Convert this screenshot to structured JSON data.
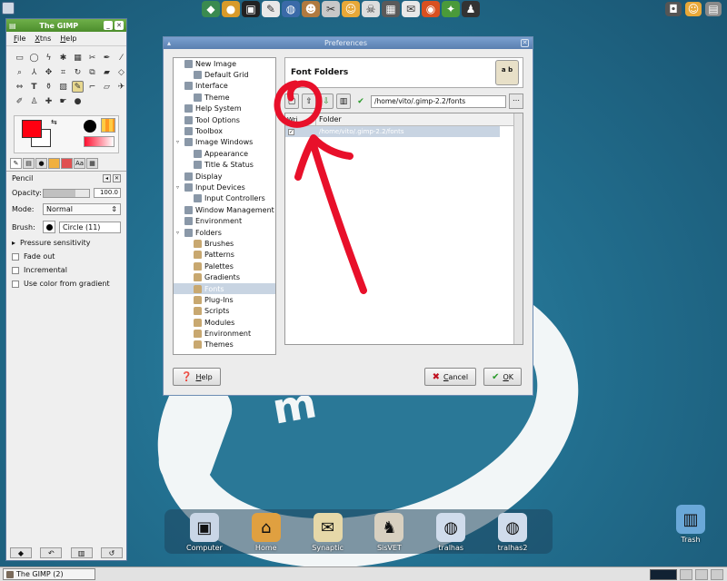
{
  "top_launchers": [
    "file-manager-icon",
    "gimp-icon",
    "terminal-icon",
    "text-editor-icon",
    "web-icon",
    "gimp-wilber-icon",
    "tools-icon",
    "cat-icon",
    "media-icon",
    "cpu-icon",
    "email-icon",
    "firefox-icon",
    "puzzle-icon",
    "penguin-icon"
  ],
  "toolbox": {
    "title": "The GIMP",
    "menu": [
      "File",
      "Xtns",
      "Help"
    ],
    "tool_options_title": "Pencil",
    "opacity_label": "Opacity:",
    "opacity_value": "100.0",
    "mode_label": "Mode:",
    "mode_value": "Normal",
    "brush_label": "Brush:",
    "brush_value": "Circle (11)",
    "pressure_label": "Pressure sensitivity",
    "options": [
      "Fade out",
      "Incremental",
      "Use color from gradient"
    ]
  },
  "prefs": {
    "title": "Preferences",
    "tree": [
      {
        "label": "New Image",
        "level": 0
      },
      {
        "label": "Default Grid",
        "level": 1
      },
      {
        "label": "Interface",
        "level": 0
      },
      {
        "label": "Theme",
        "level": 1
      },
      {
        "label": "Help System",
        "level": 0
      },
      {
        "label": "Tool Options",
        "level": 0
      },
      {
        "label": "Toolbox",
        "level": 0
      },
      {
        "label": "Image Windows",
        "level": 0,
        "expander": "▿"
      },
      {
        "label": "Appearance",
        "level": 1
      },
      {
        "label": "Title & Status",
        "level": 1
      },
      {
        "label": "Display",
        "level": 0
      },
      {
        "label": "Input Devices",
        "level": 0,
        "expander": "▿"
      },
      {
        "label": "Input Controllers",
        "level": 1
      },
      {
        "label": "Window Management",
        "level": 0
      },
      {
        "label": "Environment",
        "level": 0
      },
      {
        "label": "Folders",
        "level": 0,
        "expander": "▿"
      },
      {
        "label": "Brushes",
        "level": 1,
        "folder": true
      },
      {
        "label": "Patterns",
        "level": 1,
        "folder": true
      },
      {
        "label": "Palettes",
        "level": 1,
        "folder": true
      },
      {
        "label": "Gradients",
        "level": 1,
        "folder": true
      },
      {
        "label": "Fonts",
        "level": 1,
        "folder": true,
        "selected": true
      },
      {
        "label": "Plug-Ins",
        "level": 1,
        "folder": true
      },
      {
        "label": "Scripts",
        "level": 1,
        "folder": true
      },
      {
        "label": "Modules",
        "level": 1,
        "folder": true
      },
      {
        "label": "Environment",
        "level": 1,
        "folder": true
      },
      {
        "label": "Themes",
        "level": 1,
        "folder": true
      }
    ],
    "section_title": "Font Folders",
    "path_value": "/home/vito/.gimp-2.2/fonts",
    "col_active": "Wri",
    "col_folder": "Folder",
    "folder_entry": "/home/vito/.gimp-2.2/fonts",
    "help_label": "Help",
    "cancel_label": "Cancel",
    "ok_label": "OK"
  },
  "dock": [
    {
      "label": "Computer",
      "icon": "computer-icon",
      "color": "#c9d6e6"
    },
    {
      "label": "Home",
      "icon": "home-icon",
      "color": "#e0a040"
    },
    {
      "label": "Synaptic",
      "icon": "synaptic-icon",
      "color": "#e6d8a8"
    },
    {
      "label": "SisVET",
      "icon": "dog-icon",
      "color": "#d8d0c0"
    },
    {
      "label": "tralhas",
      "icon": "drive-icon",
      "color": "#d0dcec"
    },
    {
      "label": "tralhas2",
      "icon": "drive-icon",
      "color": "#d0dcec"
    }
  ],
  "trash_label": "Trash",
  "taskbar": {
    "task_label": "The GIMP (2)"
  },
  "colors": {
    "annotation": "#e8102a",
    "selection": "#c8d4e2"
  }
}
